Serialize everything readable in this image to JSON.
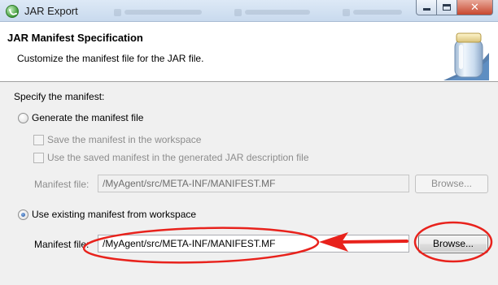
{
  "window": {
    "title": "JAR Export",
    "app_icon": "eclipse-spring-icon",
    "buttons": {
      "minimize": "minimize-icon",
      "maximize": "maximize-icon",
      "close_glyph": "✕"
    }
  },
  "banner": {
    "title": "JAR Manifest Specification",
    "description": "Customize the manifest file for the JAR file.",
    "icon": "jar-icon"
  },
  "section": {
    "label": "Specify the manifest:"
  },
  "generate": {
    "label": "Generate the manifest file",
    "selected": false,
    "save_label": "Save the manifest in the workspace",
    "use_saved_label": "Use the saved manifest in the generated JAR description file",
    "manifest_file_label": "Manifest file:",
    "manifest_file_value": "/MyAgent/src/META-INF/MANIFEST.MF",
    "browse_label": "Browse..."
  },
  "existing": {
    "label": "Use existing manifest from workspace",
    "selected": true,
    "manifest_file_label": "Manifest file:",
    "manifest_file_value": "/MyAgent/src/META-INF/MANIFEST.MF",
    "browse_label": "Browse..."
  },
  "annotation": {
    "color": "#e8221c"
  }
}
